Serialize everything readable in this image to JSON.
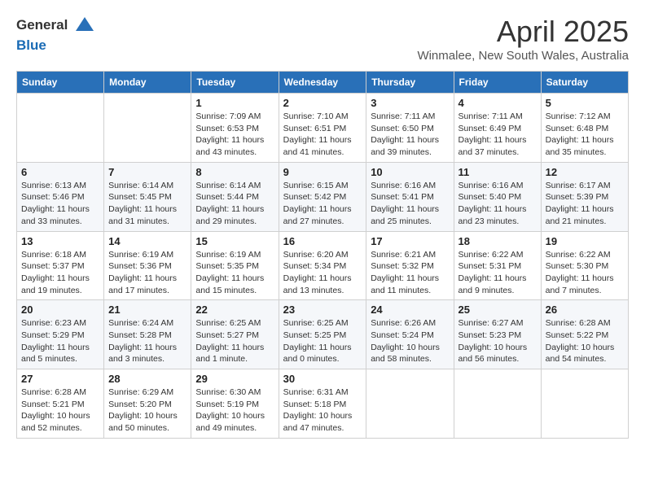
{
  "header": {
    "logo_line1": "General",
    "logo_line2": "Blue",
    "month_title": "April 2025",
    "location": "Winmalee, New South Wales, Australia"
  },
  "weekdays": [
    "Sunday",
    "Monday",
    "Tuesday",
    "Wednesday",
    "Thursday",
    "Friday",
    "Saturday"
  ],
  "weeks": [
    [
      {
        "day": "",
        "detail": ""
      },
      {
        "day": "",
        "detail": ""
      },
      {
        "day": "1",
        "detail": "Sunrise: 7:09 AM\nSunset: 6:53 PM\nDaylight: 11 hours and 43 minutes."
      },
      {
        "day": "2",
        "detail": "Sunrise: 7:10 AM\nSunset: 6:51 PM\nDaylight: 11 hours and 41 minutes."
      },
      {
        "day": "3",
        "detail": "Sunrise: 7:11 AM\nSunset: 6:50 PM\nDaylight: 11 hours and 39 minutes."
      },
      {
        "day": "4",
        "detail": "Sunrise: 7:11 AM\nSunset: 6:49 PM\nDaylight: 11 hours and 37 minutes."
      },
      {
        "day": "5",
        "detail": "Sunrise: 7:12 AM\nSunset: 6:48 PM\nDaylight: 11 hours and 35 minutes."
      }
    ],
    [
      {
        "day": "6",
        "detail": "Sunrise: 6:13 AM\nSunset: 5:46 PM\nDaylight: 11 hours and 33 minutes."
      },
      {
        "day": "7",
        "detail": "Sunrise: 6:14 AM\nSunset: 5:45 PM\nDaylight: 11 hours and 31 minutes."
      },
      {
        "day": "8",
        "detail": "Sunrise: 6:14 AM\nSunset: 5:44 PM\nDaylight: 11 hours and 29 minutes."
      },
      {
        "day": "9",
        "detail": "Sunrise: 6:15 AM\nSunset: 5:42 PM\nDaylight: 11 hours and 27 minutes."
      },
      {
        "day": "10",
        "detail": "Sunrise: 6:16 AM\nSunset: 5:41 PM\nDaylight: 11 hours and 25 minutes."
      },
      {
        "day": "11",
        "detail": "Sunrise: 6:16 AM\nSunset: 5:40 PM\nDaylight: 11 hours and 23 minutes."
      },
      {
        "day": "12",
        "detail": "Sunrise: 6:17 AM\nSunset: 5:39 PM\nDaylight: 11 hours and 21 minutes."
      }
    ],
    [
      {
        "day": "13",
        "detail": "Sunrise: 6:18 AM\nSunset: 5:37 PM\nDaylight: 11 hours and 19 minutes."
      },
      {
        "day": "14",
        "detail": "Sunrise: 6:19 AM\nSunset: 5:36 PM\nDaylight: 11 hours and 17 minutes."
      },
      {
        "day": "15",
        "detail": "Sunrise: 6:19 AM\nSunset: 5:35 PM\nDaylight: 11 hours and 15 minutes."
      },
      {
        "day": "16",
        "detail": "Sunrise: 6:20 AM\nSunset: 5:34 PM\nDaylight: 11 hours and 13 minutes."
      },
      {
        "day": "17",
        "detail": "Sunrise: 6:21 AM\nSunset: 5:32 PM\nDaylight: 11 hours and 11 minutes."
      },
      {
        "day": "18",
        "detail": "Sunrise: 6:22 AM\nSunset: 5:31 PM\nDaylight: 11 hours and 9 minutes."
      },
      {
        "day": "19",
        "detail": "Sunrise: 6:22 AM\nSunset: 5:30 PM\nDaylight: 11 hours and 7 minutes."
      }
    ],
    [
      {
        "day": "20",
        "detail": "Sunrise: 6:23 AM\nSunset: 5:29 PM\nDaylight: 11 hours and 5 minutes."
      },
      {
        "day": "21",
        "detail": "Sunrise: 6:24 AM\nSunset: 5:28 PM\nDaylight: 11 hours and 3 minutes."
      },
      {
        "day": "22",
        "detail": "Sunrise: 6:25 AM\nSunset: 5:27 PM\nDaylight: 11 hours and 1 minute."
      },
      {
        "day": "23",
        "detail": "Sunrise: 6:25 AM\nSunset: 5:25 PM\nDaylight: 11 hours and 0 minutes."
      },
      {
        "day": "24",
        "detail": "Sunrise: 6:26 AM\nSunset: 5:24 PM\nDaylight: 10 hours and 58 minutes."
      },
      {
        "day": "25",
        "detail": "Sunrise: 6:27 AM\nSunset: 5:23 PM\nDaylight: 10 hours and 56 minutes."
      },
      {
        "day": "26",
        "detail": "Sunrise: 6:28 AM\nSunset: 5:22 PM\nDaylight: 10 hours and 54 minutes."
      }
    ],
    [
      {
        "day": "27",
        "detail": "Sunrise: 6:28 AM\nSunset: 5:21 PM\nDaylight: 10 hours and 52 minutes."
      },
      {
        "day": "28",
        "detail": "Sunrise: 6:29 AM\nSunset: 5:20 PM\nDaylight: 10 hours and 50 minutes."
      },
      {
        "day": "29",
        "detail": "Sunrise: 6:30 AM\nSunset: 5:19 PM\nDaylight: 10 hours and 49 minutes."
      },
      {
        "day": "30",
        "detail": "Sunrise: 6:31 AM\nSunset: 5:18 PM\nDaylight: 10 hours and 47 minutes."
      },
      {
        "day": "",
        "detail": ""
      },
      {
        "day": "",
        "detail": ""
      },
      {
        "day": "",
        "detail": ""
      }
    ]
  ]
}
